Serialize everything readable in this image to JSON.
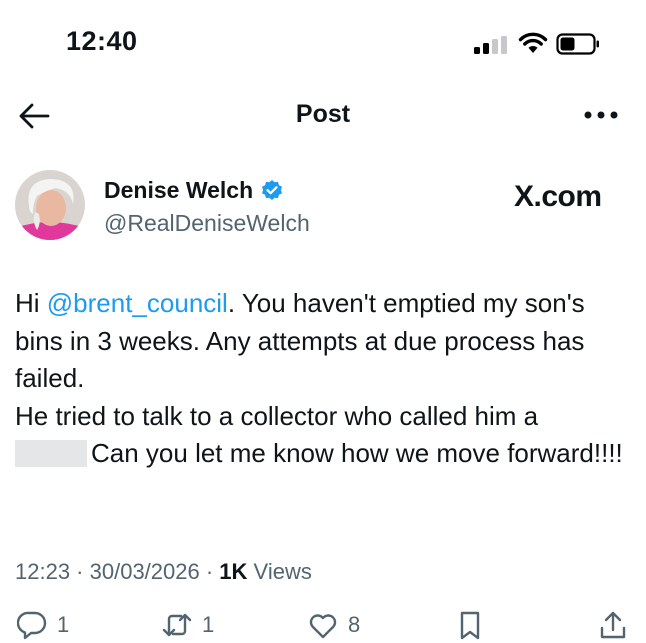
{
  "status_bar": {
    "time": "12:40"
  },
  "nav": {
    "title": "Post"
  },
  "author": {
    "display_name": "Denise Welch",
    "handle": "@RealDeniseWelch",
    "verified": true
  },
  "watermark": "X.com",
  "tweet": {
    "part1_prefix": "Hi ",
    "mention": "@brent_council",
    "part1_suffix": ". You haven't emptied my son's bins in 3 weeks. Any attempts at due process has failed.",
    "part2": "He tried to talk to a collector who called him a",
    "part3": "Can you let me know how we move forward!!!!"
  },
  "meta": {
    "time": "12:23",
    "date": "30/03/2026",
    "views_count": "1K",
    "views_label": "Views"
  },
  "actions": {
    "replies": "1",
    "reposts": "1",
    "likes": "8"
  },
  "colors": {
    "link": "#1d9bf0",
    "verified": "#1d9bf0",
    "secondary_text": "#536471"
  }
}
